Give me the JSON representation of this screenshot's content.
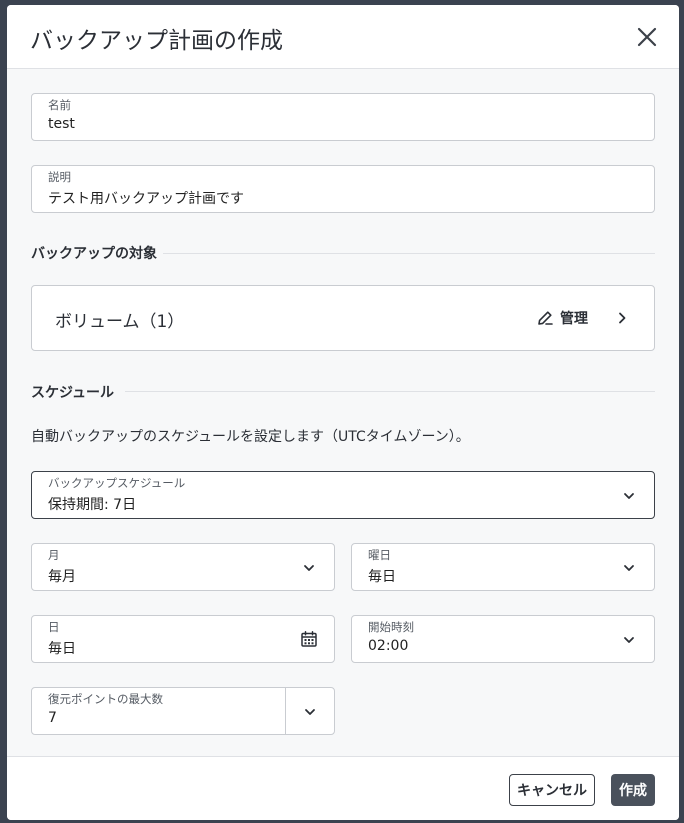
{
  "dialog": {
    "title": "バックアップ計画の作成",
    "name_field": {
      "label": "名前",
      "value": "test"
    },
    "description_field": {
      "label": "説明",
      "value": "テスト用バックアップ計画です"
    },
    "target_section": {
      "heading": "バックアップの対象",
      "volume_label": "ボリューム（1）",
      "manage_label": "管理"
    },
    "schedule_section": {
      "heading": "スケジュール",
      "description": "自動バックアップのスケジュールを設定します（UTCタイムゾーン）。",
      "backup_schedule": {
        "label": "バックアップスケジュール",
        "value": "保持期間: 7日"
      },
      "month": {
        "label": "月",
        "value": "毎月"
      },
      "weekday": {
        "label": "曜日",
        "value": "毎日"
      },
      "day": {
        "label": "日",
        "value": "毎日"
      },
      "start_time": {
        "label": "開始時刻",
        "value": "02:00"
      },
      "max_restore_points": {
        "label": "復元ポイントの最大数",
        "value": "7"
      }
    },
    "footer": {
      "cancel_label": "キャンセル",
      "create_label": "作成"
    }
  },
  "icons": {
    "close": "close-icon",
    "pencil": "pencil-icon",
    "chevron_right": "chevron-right-icon",
    "chevron_down": "chevron-down-icon",
    "calendar": "calendar-icon"
  },
  "colors": {
    "backdrop": "#3b4350",
    "primary_button": "#4a515c",
    "border": "#c9ccd1"
  }
}
